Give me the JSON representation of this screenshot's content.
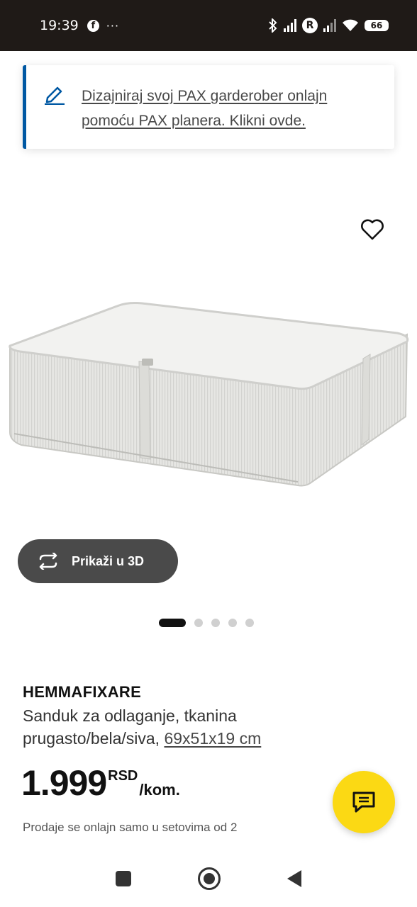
{
  "status_bar": {
    "time": "19:39",
    "dots": "···",
    "r_badge": "R",
    "battery": "66"
  },
  "banner": {
    "icon": "pencil-edit-icon",
    "text": "Dizajniraj svoj PAX garderober onlajn pomoću PAX planera. Klikni ovde."
  },
  "product": {
    "image_icon": "storage-case-image",
    "wishlist_icon": "heart-icon",
    "view_3d_label": "Prikaži u 3D",
    "carousel_dots": 5,
    "carousel_active_index": 0,
    "name": "HEMMAFIXARE",
    "description": "Sanduk za odlaganje, tkanina prugasto/bela/siva,",
    "size": "69x51x19 cm",
    "price": "1.999",
    "currency": "RSD",
    "unit": "/kom.",
    "note": "Prodaje se onlajn samo u setovima od 2"
  },
  "colors": {
    "accent_blue": "#0058a3",
    "chat_yellow": "#fbd914",
    "status_bar": "#1f1a17"
  },
  "nav": {
    "recent_icon": "square-icon",
    "home_icon": "circle-home-icon",
    "back_icon": "triangle-back-icon"
  }
}
